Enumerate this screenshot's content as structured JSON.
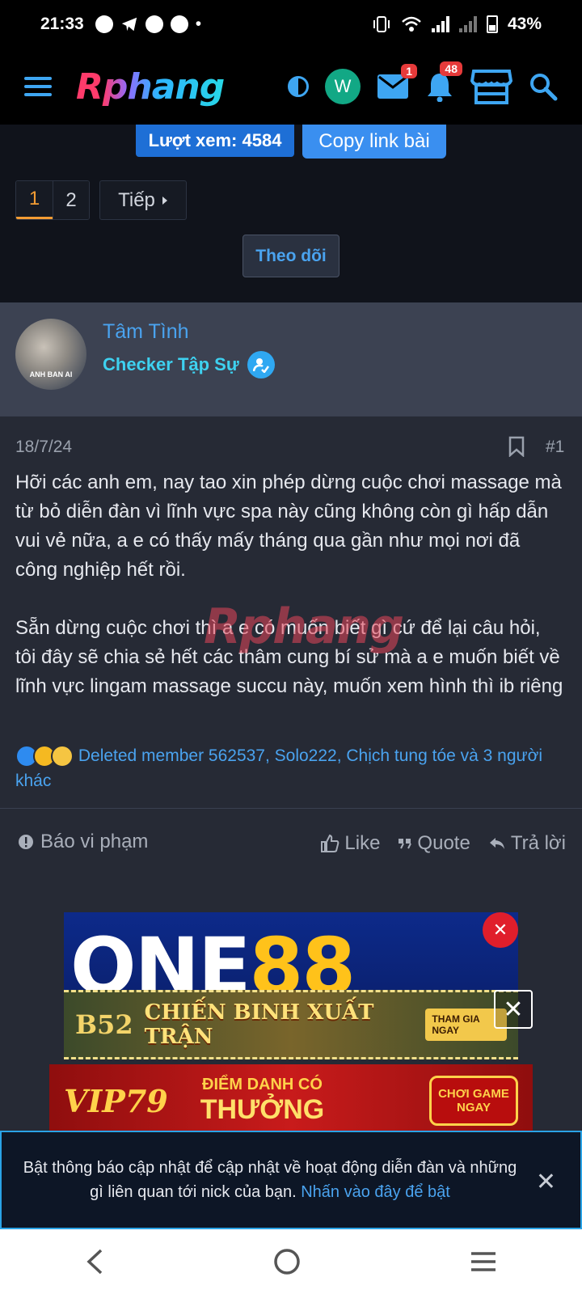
{
  "status_bar": {
    "time": "21:33",
    "battery": "43%"
  },
  "header": {
    "logo": "Rphang",
    "inbox_badge": "1",
    "alerts_badge": "48"
  },
  "thread": {
    "views_label": "Lượt xem: 4584",
    "copy_link_label": "Copy link bài",
    "pages": [
      "1",
      "2"
    ],
    "next_label": "Tiếp",
    "follow_label": "Theo dõi"
  },
  "author": {
    "name": "Tâm Tình",
    "title": "Checker Tập Sự",
    "avatar_caption": "ANH BAN AI"
  },
  "post": {
    "date": "18/7/24",
    "number": "#1",
    "paragraphs": [
      "Hỡi các anh em, nay tao xin phép dừng cuộc chơi massage mà từ bỏ diễn đàn vì lĩnh vực spa này cũng không còn gì hấp dẫn vui vẻ nữa, a e có thấy mấy tháng qua gần như mọi nơi đã công nghiệp hết rồi.",
      "Sẵn dừng cuộc chơi thì a e có muốn biết gì cứ để lại câu hỏi, tôi đây sẽ chia sẻ hết các thâm cung bí sử mà a e muốn biết về lĩnh vực lingam massage succu này, muốn xem hình thì ib riêng"
    ],
    "watermark": "Rphang",
    "reactions_text": "Deleted member 562537, Solo222, Chịch tung tóe và 3 người khác"
  },
  "actions": {
    "report": "Báo vi phạm",
    "like": "Like",
    "quote": "Quote",
    "reply": "Trả lời"
  },
  "ads": {
    "ad1_text_a": "ONE",
    "ad1_text_b": "88",
    "ad2_brand": "B52",
    "ad2_title": "CHIẾN BINH XUẤT TRẬN",
    "ad2_cta": "THAM GIA NGAY",
    "ad3_brand": "VIP79",
    "ad3_small": "ĐIỂM DANH CÓ",
    "ad3_big": "THƯỞNG",
    "ad3_cta": "CHƠI GAME NGAY"
  },
  "notice": {
    "text": "Bật thông báo cập nhật để cập nhật về hoạt động diễn đàn và những gì liên quan tới nick của bạn. ",
    "link": "Nhấn vào đây để bật"
  },
  "colors": {
    "accent": "#3ea6f2",
    "link": "#4aa3ef",
    "active_page": "#f39c33",
    "badge": "#e63a3a"
  }
}
